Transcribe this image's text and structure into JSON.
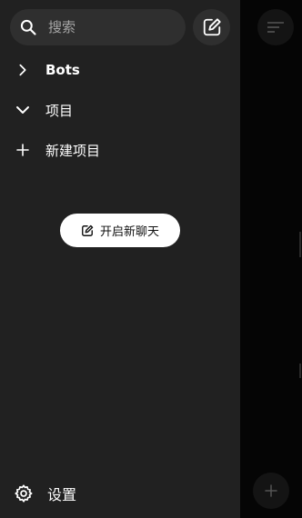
{
  "search": {
    "placeholder": "搜索",
    "icon": "search-icon"
  },
  "header": {
    "new_chat_icon": "compose-icon"
  },
  "menu": [
    {
      "label": "Bots",
      "icon": "chevron-right-icon"
    },
    {
      "label": "项目",
      "icon": "chevron-down-icon"
    },
    {
      "label": "新建项目",
      "icon": "plus-icon"
    }
  ],
  "start_chat": {
    "label": "开启新聊天",
    "icon": "compose-icon"
  },
  "footer": {
    "settings_label": "设置",
    "icon": "gear-icon"
  },
  "colors": {
    "drawer_bg": "#212121",
    "pill_bg": "#2f2f2f",
    "backdrop": "#050505",
    "accent_button": "#ffffff"
  }
}
